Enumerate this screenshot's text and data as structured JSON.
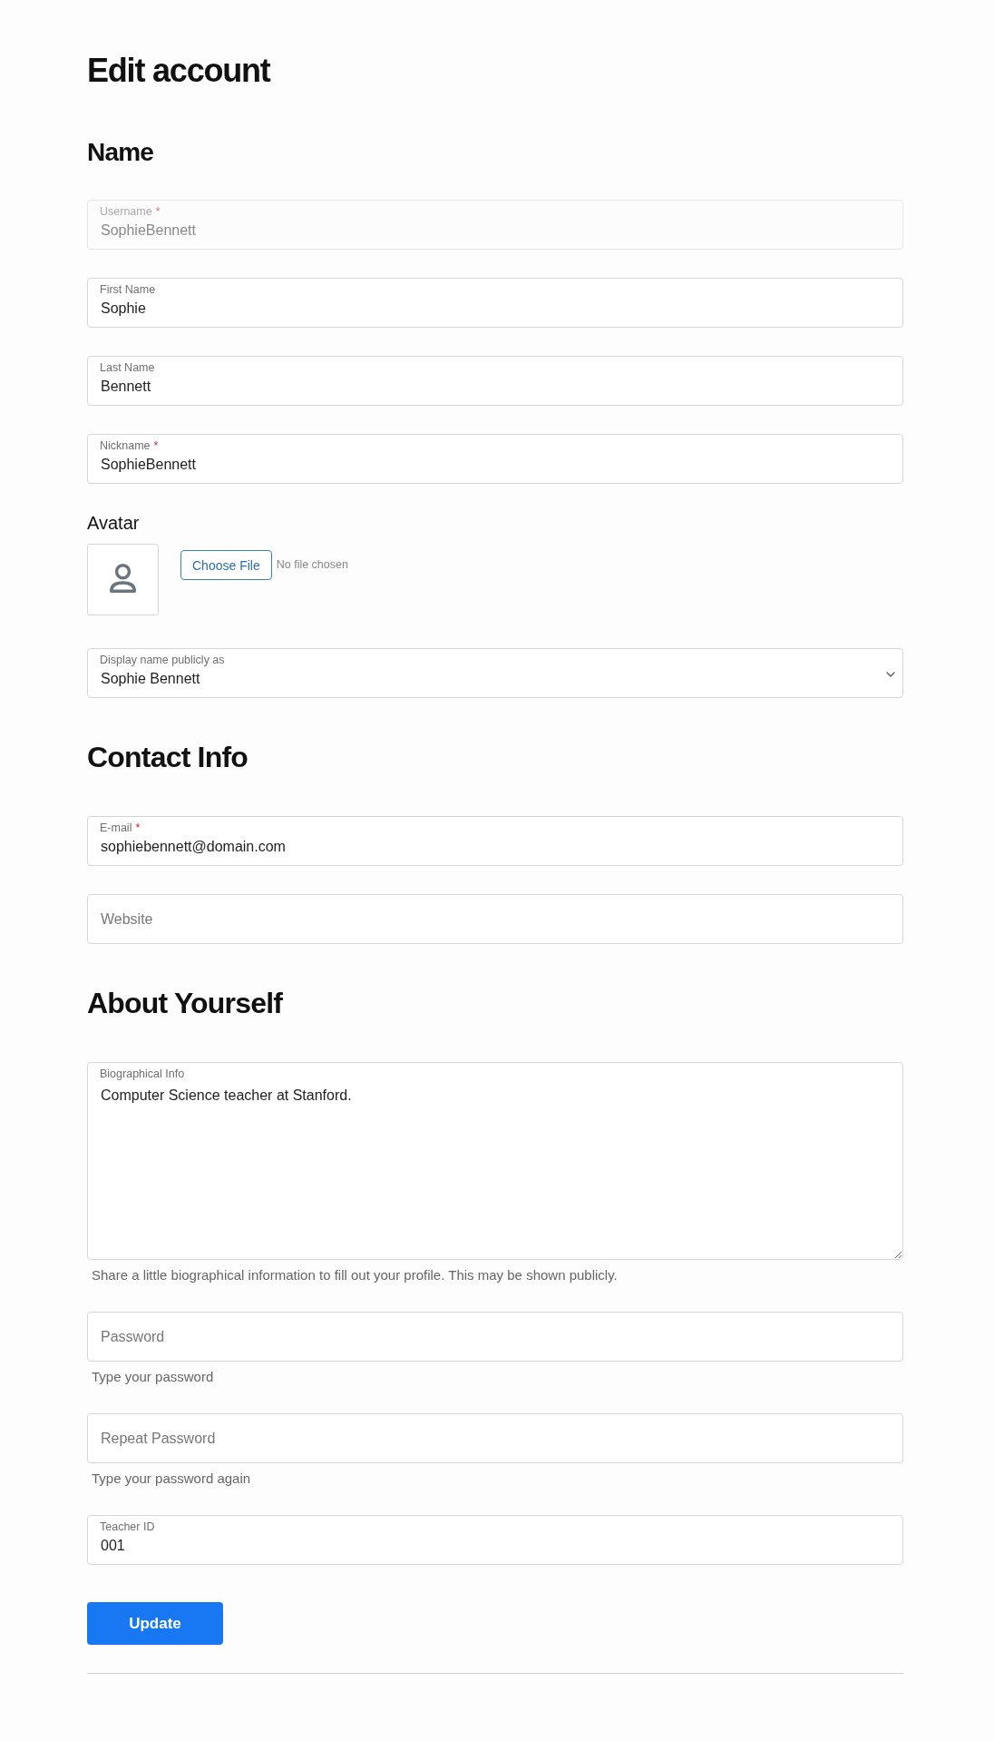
{
  "title": "Edit account",
  "sections": [
    {
      "kind": "subheading",
      "heading": "Name",
      "fields": [
        {
          "kind": "input",
          "label": "Username",
          "required_mark": "*",
          "value": "SophieBennett",
          "disabled": true
        },
        {
          "kind": "input",
          "label": "First Name",
          "value": "Sophie",
          "disabled": false
        },
        {
          "kind": "input",
          "label": "Last Name",
          "value": "Bennett",
          "disabled": false
        },
        {
          "kind": "input",
          "label": "Nickname",
          "required_mark": "*",
          "value": "SophieBennett",
          "disabled": false
        },
        {
          "kind": "avatar",
          "label": "Avatar",
          "button": "Choose File",
          "file_status": "No file chosen",
          "disabled": false
        },
        {
          "kind": "select",
          "label": "Display name publicly as",
          "value": "Sophie Bennett",
          "disabled": false
        }
      ]
    },
    {
      "kind": "heading",
      "heading": "Contact Info",
      "fields": [
        {
          "kind": "input",
          "label": "E-mail",
          "required_mark": "*",
          "value": "sophiebennett@domain.com",
          "disabled": false
        },
        {
          "kind": "input",
          "placeholder": "Website",
          "disabled": false
        }
      ]
    },
    {
      "kind": "heading",
      "heading": "About Yourself",
      "fields": [
        {
          "kind": "textarea",
          "label": "Biographical Info",
          "value": "Computer Science teacher at Stanford.",
          "help": "Share a little biographical information to fill out your profile. This may be shown publicly.",
          "disabled": false
        },
        {
          "kind": "input",
          "placeholder": "Password",
          "help": "Type your password",
          "disabled": false
        },
        {
          "kind": "input",
          "placeholder": "Repeat Password",
          "help": "Type your password again",
          "disabled": false
        },
        {
          "kind": "input",
          "label": "Teacher ID",
          "value": "001",
          "disabled": false
        }
      ]
    }
  ],
  "submit_button": "Update"
}
